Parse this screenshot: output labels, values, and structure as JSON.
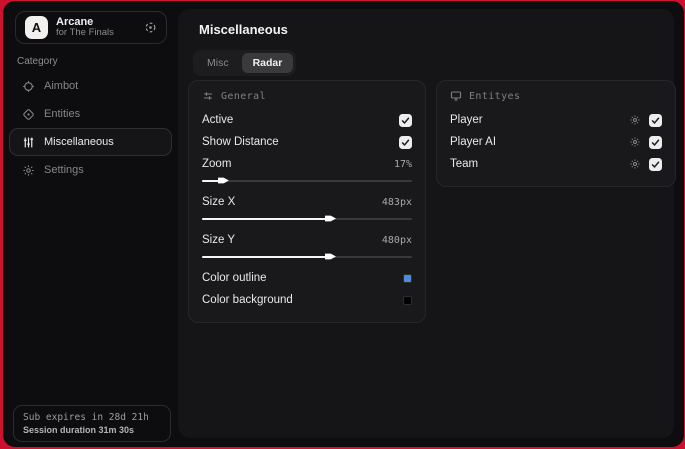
{
  "accent": {
    "edge_color": "#cf1130",
    "checkbox_bg": "#ededed"
  },
  "sidebar": {
    "logo": {
      "initial": "A",
      "title": "Arcane",
      "subtitle": "for The Finals"
    },
    "category_label": "Category",
    "items": [
      {
        "label": "Aimbot",
        "icon": "crosshair-icon",
        "active": false
      },
      {
        "label": "Entities",
        "icon": "entities-icon",
        "active": false
      },
      {
        "label": "Miscellaneous",
        "icon": "sliders-icon",
        "active": true
      },
      {
        "label": "Settings",
        "icon": "gear-icon",
        "active": false
      }
    ],
    "subscription": {
      "expires": "Sub expires in 28d 21h",
      "session": "Session duration 31m 30s"
    }
  },
  "main": {
    "title": "Miscellaneous",
    "tabs": {
      "misc": "Misc",
      "radar": "Radar",
      "active_tab": "Radar"
    },
    "general": {
      "title": "General",
      "active": {
        "label": "Active",
        "checked": true
      },
      "show_distance": {
        "label": "Show Distance",
        "checked": true
      },
      "zoom": {
        "label": "Zoom",
        "value": "17%",
        "percent": 9
      },
      "size_x": {
        "label": "Size X",
        "value": "483px",
        "percent": 60
      },
      "size_y": {
        "label": "Size Y",
        "value": "480px",
        "percent": 60
      },
      "color_outline": {
        "label": "Color outline",
        "color": "#4f8bd6"
      },
      "color_background": {
        "label": "Color background",
        "color": "#000000"
      }
    },
    "entities": {
      "title": "Entityes",
      "rows": [
        {
          "label": "Player",
          "checked": true
        },
        {
          "label": "Player AI",
          "checked": true
        },
        {
          "label": "Team",
          "checked": true
        }
      ]
    }
  }
}
